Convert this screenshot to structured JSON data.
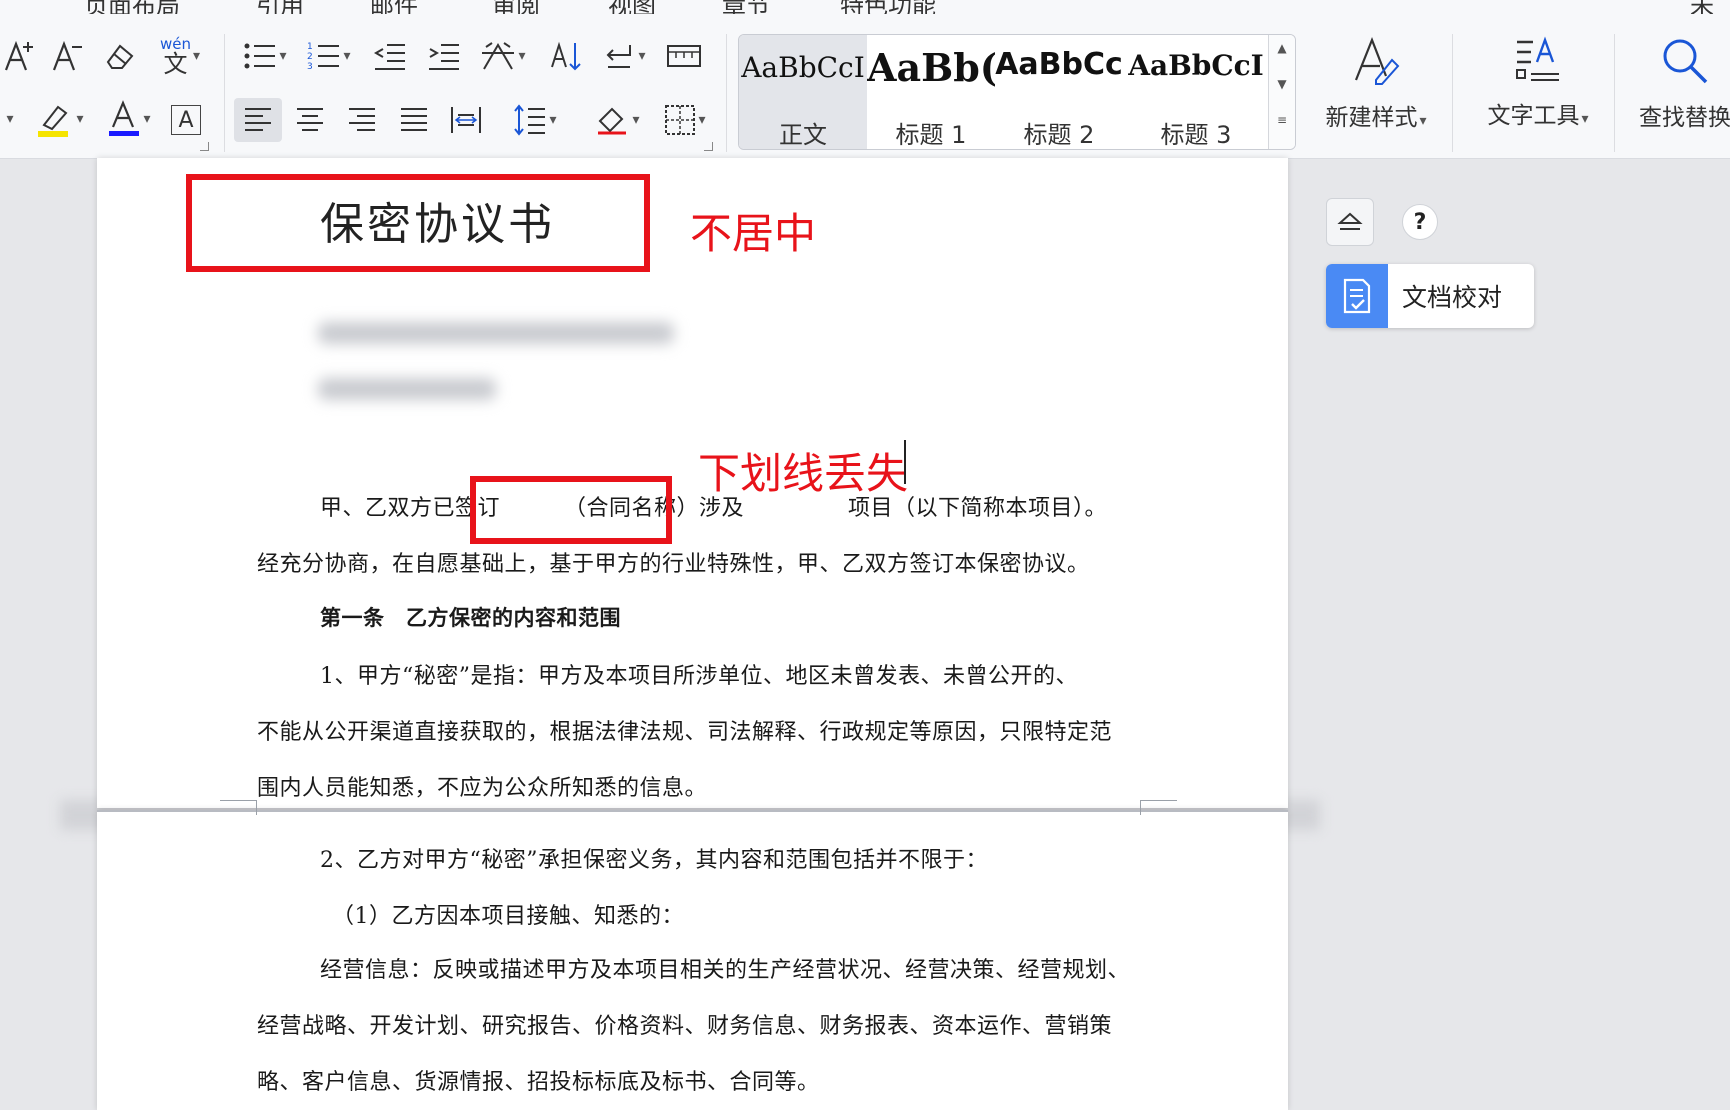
{
  "menu": {
    "items": [
      "页面布局",
      "引用",
      "邮件",
      "审阅",
      "视图",
      "章节",
      "特色功能"
    ],
    "right": "未"
  },
  "ribbon": {
    "styles": [
      {
        "sample": "AaBbCcI",
        "label": "正文",
        "active": true
      },
      {
        "sample": "AaBb(",
        "label": "标题 1"
      },
      {
        "sample": "AaBbCc",
        "label": "标题 2"
      },
      {
        "sample": "AaBbCcI",
        "label": "标题 3"
      }
    ],
    "new_style_label": "新建样式",
    "text_tool_label": "文字工具",
    "find_replace_label": "查找替换",
    "pinyin_glyph": "wén",
    "pinyin_char": "文",
    "char_border_glyph": "A"
  },
  "document": {
    "title": "保密协议书",
    "p1_line1": {
      "before": "甲、乙双方已签订",
      "contract_name": "（合同名称）涉及",
      "after": "项目（以下简称本项目）。"
    },
    "p1_line2": "经充分协商，在自愿基础上，基于甲方的行业特殊性，甲、乙双方签订本保密协议。",
    "article1_heading": "第一条　乙方保密的内容和范围",
    "a1_line1": "1、甲方“秘密”是指：甲方及本项目所涉单位、地区未曾发表、未曾公开的、",
    "a1_line2": "不能从公开渠道直接获取的，根据法律法规、司法解释、行政规定等原因，只限特定范",
    "a1_line3": "围内人员能知悉，不应为公众所知悉的信息。",
    "a2_line1": "2、乙方对甲方“秘密”承担保密义务，其内容和范围包括并不限于：",
    "a2_line2": "（1）乙方因本项目接触、知悉的：",
    "a2_line3": "经营信息：反映或描述甲方及本项目相关的生产经营状况、经营决策、经营规划、",
    "a2_line4": "经营战略、开发计划、研究报告、价格资料、财务信息、财务报表、资本运作、营销策",
    "a2_line5": "略、客户信息、货源情报、招投标标底及标书、合同等。"
  },
  "annotations": {
    "not_centered": "不居中",
    "underline_lost": "下划线丢失"
  },
  "right_panel": {
    "help_glyph": "?",
    "proofread_label": "文档校对"
  },
  "colors": {
    "annotation_red": "#e8131a",
    "accent_blue": "#4a8af4",
    "highlight_yellow": "#f5e400",
    "font_color_blue": "#1a1aff"
  }
}
